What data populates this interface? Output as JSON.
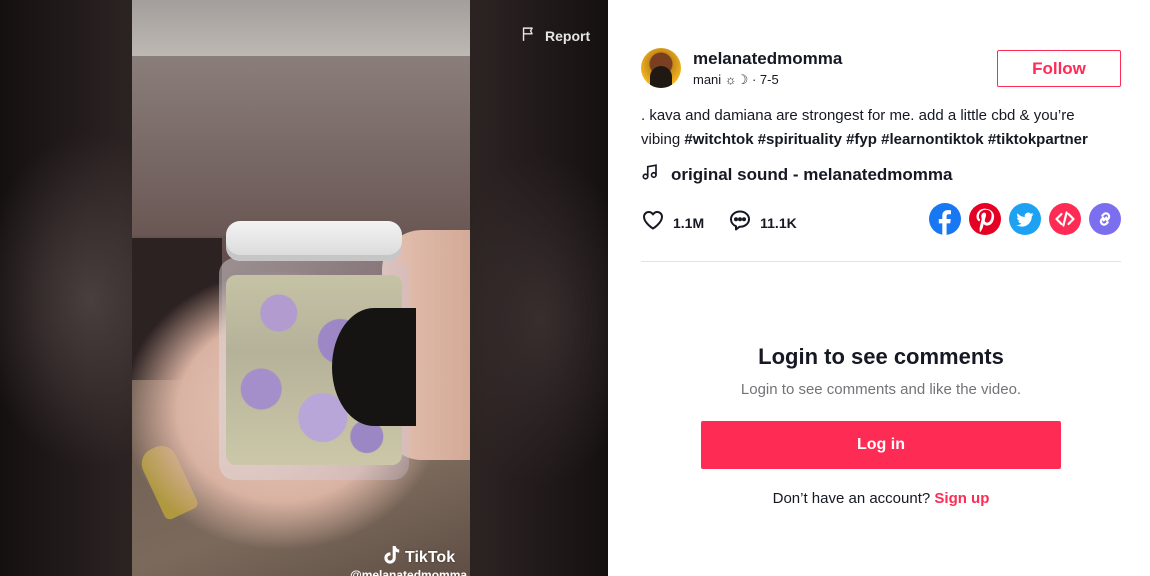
{
  "video": {
    "report_label": "Report",
    "watermark_label": "TikTok",
    "watermark_handle": "@melanatedmomma"
  },
  "author": {
    "username": "melanatedmomma",
    "nickname": "mani ☼☽",
    "separator": " · ",
    "date": "7-5"
  },
  "follow_label": "Follow",
  "caption": {
    "text": ". kava and damiana are strongest for me. add a little cbd & you’re vibing ",
    "hashtags": [
      "#witchtok",
      "#spirituality",
      "#fyp",
      "#learnontiktok",
      "#tiktokpartner"
    ]
  },
  "music": {
    "label": "original sound - melanatedmomma",
    "icon": "music-note-icon"
  },
  "stats": {
    "likes": "1.1M",
    "comments": "11.1K"
  },
  "share": [
    {
      "name": "facebook",
      "icon": "facebook-icon",
      "color": "#1877f2"
    },
    {
      "name": "pinterest",
      "icon": "pinterest-icon",
      "color": "#e60023"
    },
    {
      "name": "twitter",
      "icon": "twitter-icon",
      "color": "#1da1f2"
    },
    {
      "name": "embed",
      "icon": "embed-code-icon",
      "color": "#fe2c55"
    },
    {
      "name": "copy-link",
      "icon": "link-icon",
      "color": "#7b6ff0"
    }
  ],
  "login": {
    "title": "Login to see comments",
    "subtitle": "Login to see comments and like the video.",
    "button_label": "Log in",
    "signup_prompt": "Don’t have an account? ",
    "signup_link": "Sign up"
  },
  "colors": {
    "accent": "#fe2c55",
    "text": "#161823",
    "muted": "#737478"
  }
}
